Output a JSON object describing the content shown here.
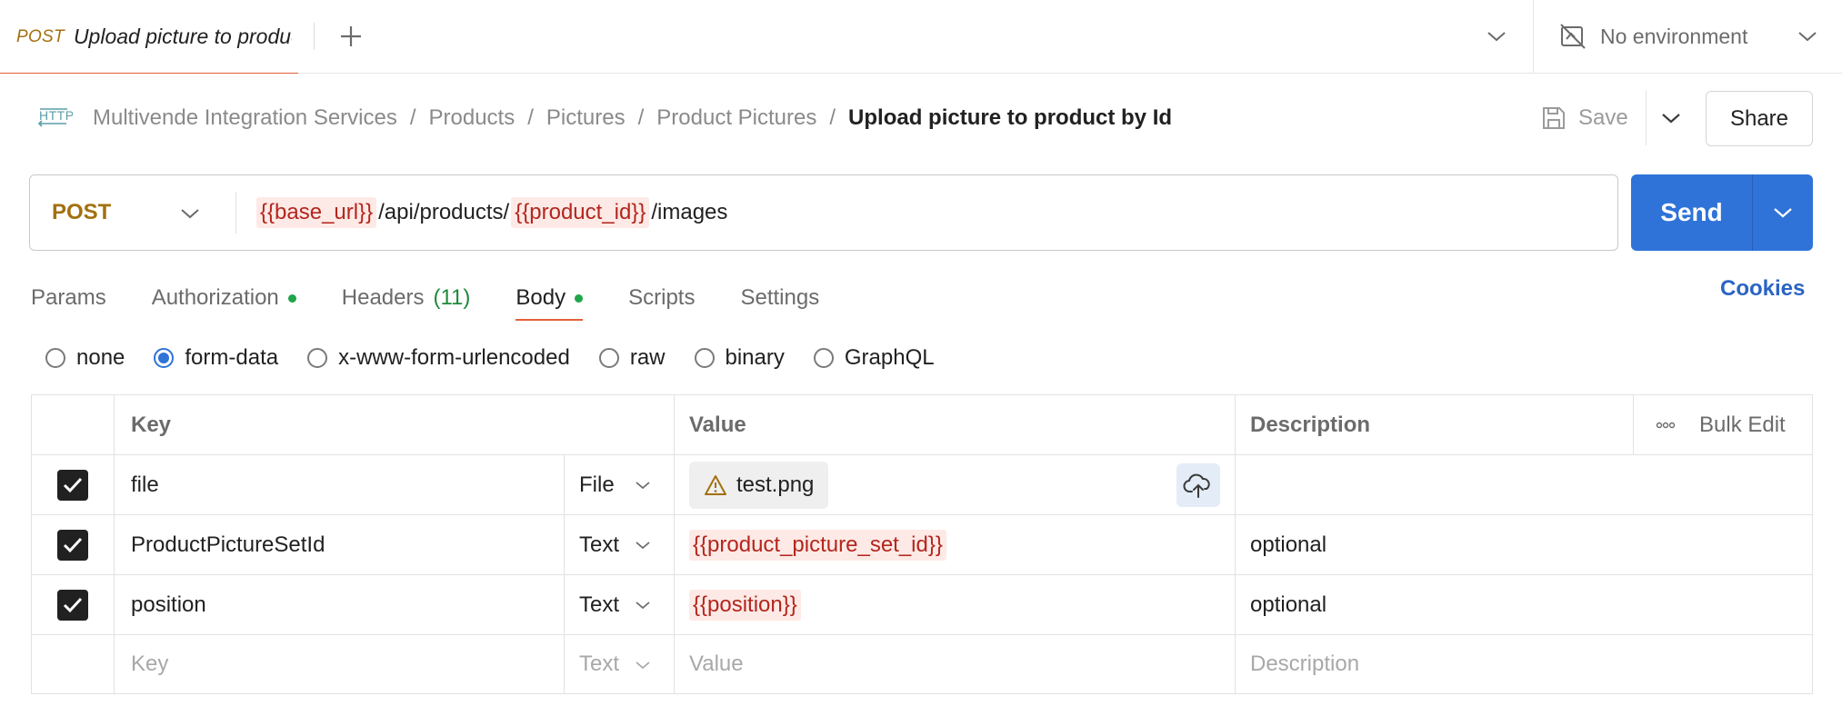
{
  "tabbar": {
    "active_tab": {
      "method": "POST",
      "name": "Upload picture to product by Id"
    },
    "environment": "No environment"
  },
  "breadcrumb": {
    "icon": "http-icon",
    "items": [
      "Multivende Integration Services",
      "Products",
      "Pictures",
      "Product Pictures"
    ],
    "separator": "/",
    "current": "Upload picture to product by Id"
  },
  "actions": {
    "save_label": "Save",
    "share_label": "Share"
  },
  "request": {
    "method": "POST",
    "url_parts": [
      {
        "text": "{{base_url}}",
        "variable": true
      },
      {
        "text": "/api/products/",
        "variable": false
      },
      {
        "text": "{{product_id}}",
        "variable": true
      },
      {
        "text": "/images",
        "variable": false
      }
    ],
    "send_label": "Send"
  },
  "request_tabs": {
    "params": "Params",
    "authorization": "Authorization",
    "headers": "Headers",
    "headers_count": "(11)",
    "body": "Body",
    "scripts": "Scripts",
    "settings": "Settings",
    "active": "Body",
    "cookies": "Cookies"
  },
  "body_types": {
    "options": [
      "none",
      "form-data",
      "x-www-form-urlencoded",
      "raw",
      "binary",
      "GraphQL"
    ],
    "selected": "form-data"
  },
  "table": {
    "headers": {
      "key": "Key",
      "value": "Value",
      "description": "Description",
      "bulk_edit": "Bulk Edit"
    },
    "rows": [
      {
        "checked": true,
        "key": "file",
        "type": "File",
        "value": "test.png",
        "value_kind": "file",
        "description": ""
      },
      {
        "checked": true,
        "key": "ProductPictureSetId",
        "type": "Text",
        "value": "{{product_picture_set_id}}",
        "value_kind": "variable",
        "description": "optional"
      },
      {
        "checked": true,
        "key": "position",
        "type": "Text",
        "value": "{{position}}",
        "value_kind": "variable",
        "description": "optional"
      }
    ],
    "empty_row": {
      "key": "Key",
      "type": "Text",
      "value": "Value",
      "description": "Description"
    }
  },
  "colors": {
    "post_method": "#a3700f",
    "accent_tab": "#e4603a",
    "send_button": "#2f73d9",
    "variable_bg": "#fde9e5",
    "variable_text": "#b3261e",
    "status_dot": "#1fa64a",
    "cookies_link": "#2a64c4"
  }
}
